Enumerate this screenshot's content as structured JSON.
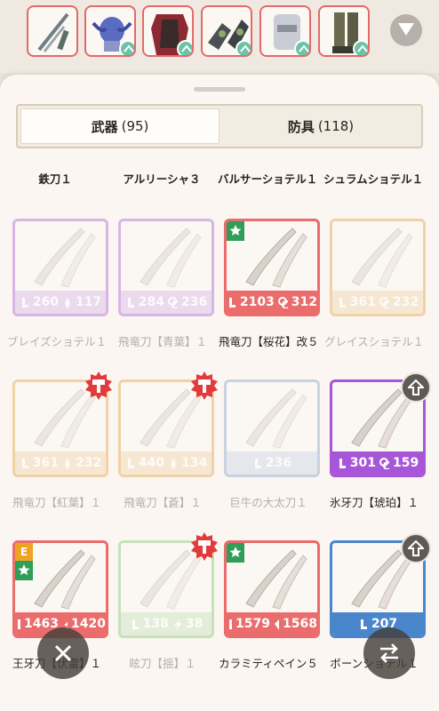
{
  "equipped": {
    "slots": [
      {
        "name": "weapon",
        "icon": "katana-icon",
        "swap": false
      },
      {
        "name": "head",
        "icon": "helmet-icon",
        "swap": true
      },
      {
        "name": "chest",
        "icon": "chest-armor-icon",
        "swap": true
      },
      {
        "name": "arms",
        "icon": "gauntlet-icon",
        "swap": true
      },
      {
        "name": "waist",
        "icon": "waist-armor-icon",
        "swap": true
      },
      {
        "name": "legs",
        "icon": "leg-armor-icon",
        "swap": true
      }
    ],
    "dropdown_icon": "chevron-down-icon"
  },
  "tabs": {
    "weapons": {
      "label": "武器",
      "count": "(95)"
    },
    "armor": {
      "label": "防具",
      "count": "(118)"
    }
  },
  "top_names": [
    "鉄刀１",
    "アルリーシャ３",
    "バルサーショテル１",
    "シュラムショテル１"
  ],
  "rows": [
    {
      "items": [
        {
          "color": "purple",
          "faded": true,
          "attack": "260",
          "stat2": "117",
          "stat2_icon": "water-drop-icon",
          "name": "ブレイズショテル１",
          "name_faded": true
        },
        {
          "color": "purple",
          "faded": true,
          "attack": "284",
          "stat2": "236",
          "stat2_icon": "affinity-icon",
          "name": "飛竜刀【青葉】１",
          "name_faded": true
        },
        {
          "color": "red",
          "faded": false,
          "attack": "2103",
          "stat2": "312",
          "stat2_icon": "blast-icon",
          "name": "飛竜刀【桜花】改５",
          "name_faded": false,
          "star": true
        },
        {
          "color": "tan",
          "faded": true,
          "attack": "361",
          "stat2": "232",
          "stat2_icon": "affinity-icon",
          "name": "グレイスショテル１",
          "name_faded": true
        }
      ]
    },
    {
      "items": [
        {
          "color": "tan",
          "faded": true,
          "attack": "361",
          "stat2": "232",
          "stat2_icon": "water-drop-icon",
          "name": "飛竜刀【紅葉】１",
          "name_faded": true,
          "hammer": true
        },
        {
          "color": "tan",
          "faded": true,
          "attack": "440",
          "stat2": "134",
          "stat2_icon": "water-drop-icon",
          "name": "飛竜刀【蒼】１",
          "name_faded": true,
          "hammer": true
        },
        {
          "color": "slate",
          "faded": true,
          "attack": "236",
          "stat2": "",
          "stat2_icon": "",
          "name": "巨牛の大太刀１",
          "name_faded": true
        },
        {
          "color": "violet",
          "faded": false,
          "attack": "301",
          "stat2": "159",
          "stat2_icon": "affinity-icon",
          "name": "氷牙刀【琥珀】１",
          "name_faded": false,
          "upgrade": true
        }
      ]
    },
    {
      "items": [
        {
          "color": "red",
          "faded": false,
          "attack": "1463",
          "stat2": "1420",
          "stat2_icon": "thunder-icon",
          "name": "王牙刀【伏雷】１",
          "name_faded": false,
          "star": true,
          "e_badge": "E"
        },
        {
          "color": "green",
          "faded": true,
          "attack": "138",
          "stat2": "38",
          "stat2_icon": "thunder-icon",
          "name": "眩刀【揺】１",
          "name_faded": true,
          "hammer": true
        },
        {
          "color": "red",
          "faded": false,
          "attack": "1579",
          "stat2": "1568",
          "stat2_icon": "dragon-icon",
          "name": "カラミティペイン５",
          "name_faded": false,
          "star": true
        },
        {
          "color": "blue",
          "faded": false,
          "attack": "207",
          "stat2": "",
          "stat2_icon": "",
          "name": "ボーンショテル１",
          "name_faded": false,
          "upgrade": true
        }
      ]
    }
  ],
  "colors": {
    "purple": "#d7b6e6",
    "red": "#ea6c6c",
    "tan": "#f0d2a8",
    "slate": "#c9d2e2",
    "violet": "#a856d8",
    "green": "#c5e2bb",
    "blue": "#4a86cc"
  },
  "buttons": {
    "close_icon": "close-icon",
    "swap_icon": "swap-arrows-icon"
  }
}
